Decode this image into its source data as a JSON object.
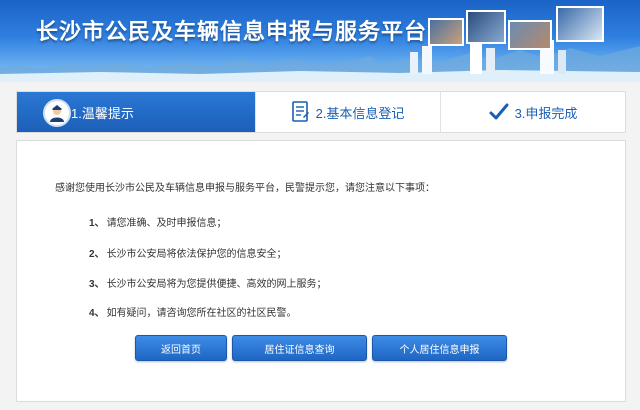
{
  "header": {
    "title": "长沙市公民及车辆信息申报与服务平台",
    "logo_icon": "city-banner-icon"
  },
  "steps": [
    {
      "label": "1.温馨提示",
      "icon": "police-avatar-icon",
      "active": true
    },
    {
      "label": "2.基本信息登记",
      "icon": "form-document-icon",
      "active": false
    },
    {
      "label": "3.申报完成",
      "icon": "checkmark-icon",
      "active": false
    }
  ],
  "content": {
    "intro": "感谢您使用长沙市公民及车辆信息申报与服务平台，民警提示您，请您注意以下事项：",
    "notices": [
      {
        "num": "1、",
        "text": "请您准确、及时申报信息；"
      },
      {
        "num": "2、",
        "text": "长沙市公安局将依法保护您的信息安全；"
      },
      {
        "num": "3、",
        "text": "长沙市公安局将为您提供便捷、高效的网上服务；"
      },
      {
        "num": "4、",
        "text": "如有疑问，请咨询您所在社区的社区民警。"
      }
    ]
  },
  "buttons": {
    "home": "返回首页",
    "residence_query": "居住证信息查询",
    "personal_declare": "个人居住信息申报"
  },
  "colors": {
    "brand_blue": "#1f66c4",
    "banner_top": "#1b63c6"
  }
}
